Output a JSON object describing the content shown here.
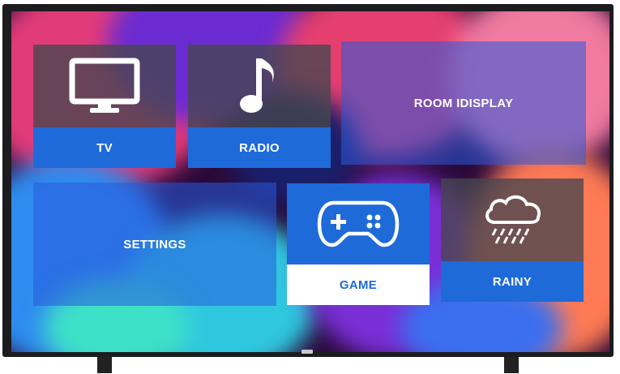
{
  "tiles": {
    "tv": {
      "label": "TV",
      "icon": "tv-icon"
    },
    "radio": {
      "label": "RADIO",
      "icon": "music-note-icon"
    },
    "room_display": {
      "label": "ROOM IDISPLAY"
    },
    "settings": {
      "label": "SETTINGS"
    },
    "game": {
      "label": "GAME",
      "icon": "gamepad-icon",
      "state": "selected"
    },
    "rainy": {
      "label": "RAINY",
      "icon": "rain-cloud-icon"
    }
  },
  "colors": {
    "accent": "#1e6ad8",
    "tile_dark": "#46464f",
    "frame": "#1c1c1e"
  }
}
